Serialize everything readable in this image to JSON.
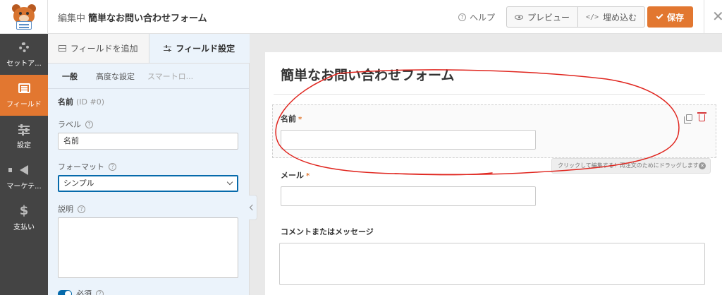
{
  "header": {
    "editing_prefix": "編集中",
    "form_name": "簡単なお問い合わせフォーム",
    "help_label": "ヘルプ",
    "preview_label": "プレビュー",
    "embed_label": "埋め込む",
    "save_label": "保存",
    "accent_color": "#e27730"
  },
  "sidebar": {
    "items": [
      {
        "label": "セットア...",
        "icon": "gear-icon"
      },
      {
        "label": "フィールド",
        "icon": "fields-icon"
      },
      {
        "label": "設定",
        "icon": "sliders-icon"
      },
      {
        "label": "マーケテ...",
        "icon": "megaphone-icon"
      },
      {
        "label": "支払い",
        "icon": "dollar-icon"
      }
    ],
    "active_index": 1
  },
  "panel": {
    "tabs": {
      "add_fields": "フィールドを追加",
      "field_options": "フィールド設定"
    },
    "subtabs": {
      "general": "一般",
      "advanced": "高度な設定",
      "smart": "スマートロ..."
    },
    "field_heading": "名前",
    "field_id": "(ID #0)",
    "label_caption": "ラベル",
    "label_value": "名前",
    "format_caption": "フォーマット",
    "format_value": "シンプル",
    "description_caption": "説明",
    "required_caption": "必須",
    "required_on": true
  },
  "form": {
    "title": "簡単なお問い合わせフォーム",
    "required_mark": "*",
    "fields": {
      "name_label": "名前",
      "email_label": "メール",
      "comment_label": "コメントまたはメッセージ"
    },
    "hint": "クリックして編集する！再注文のためにドラッグします"
  }
}
